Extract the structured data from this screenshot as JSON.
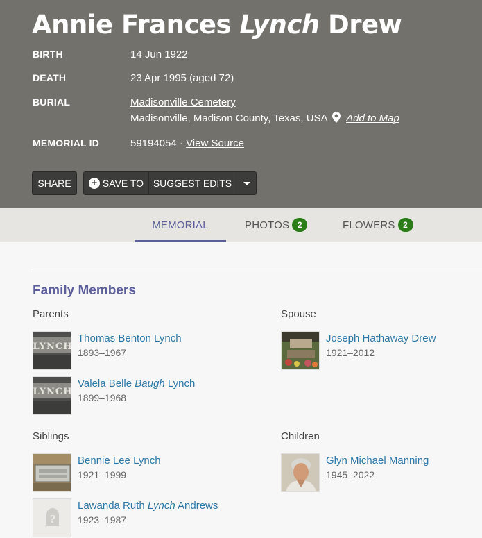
{
  "memorial": {
    "first_names": "Annie Frances",
    "maiden_name": "Lynch",
    "last_name": "Drew",
    "birth_label": "BIRTH",
    "birth_value": "14 Jun 1922",
    "death_label": "DEATH",
    "death_value": "23 Apr 1995 (aged 72)",
    "burial_label": "BURIAL",
    "burial_cemetery": "Madisonville Cemetery",
    "burial_location": "Madisonville, Madison County, Texas, USA",
    "add_to_map": "Add to Map",
    "memorial_id_label": "MEMORIAL ID",
    "memorial_id_value": "59194054 ·",
    "view_source": "View Source"
  },
  "actions": {
    "share": "SHARE",
    "save_to": "SAVE TO",
    "suggest_edits": "SUGGEST EDITS"
  },
  "tabs": [
    {
      "label": "MEMORIAL"
    },
    {
      "label": "PHOTOS",
      "count": "2"
    },
    {
      "label": "FLOWERS",
      "count": "2"
    }
  ],
  "family": {
    "title": "Family Members",
    "parents_title": "Parents",
    "spouse_title": "Spouse",
    "siblings_title": "Siblings",
    "children_title": "Children",
    "parents": [
      {
        "name_pre": "Thomas Benton Lynch",
        "name_italic": "",
        "name_post": "",
        "dates": "1893–1967"
      },
      {
        "name_pre": "Valela Belle ",
        "name_italic": "Baugh",
        "name_post": " Lynch",
        "dates": "1899–1968"
      }
    ],
    "spouse": [
      {
        "name_pre": "Joseph Hathaway Drew",
        "name_italic": "",
        "name_post": "",
        "dates": "1921–2012"
      }
    ],
    "siblings": [
      {
        "name_pre": "Bennie Lee Lynch",
        "name_italic": "",
        "name_post": "",
        "dates": "1921–1999"
      },
      {
        "name_pre": "Lawanda Ruth ",
        "name_italic": "Lynch",
        "name_post": " Andrews",
        "dates": "1923–1987"
      }
    ],
    "children": [
      {
        "name_pre": "Glyn Michael Manning",
        "name_italic": "",
        "name_post": "",
        "dates": "1945–2022"
      }
    ]
  }
}
